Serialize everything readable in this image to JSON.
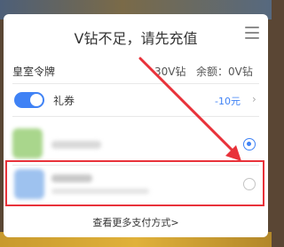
{
  "dialog": {
    "title": "V钻不足，请先充值"
  },
  "purchase": {
    "product_name": "皇室令牌",
    "price": "30V钻",
    "balance": "余额：0V钻"
  },
  "coupon": {
    "label": "礼券",
    "enabled": true,
    "value": "-10元",
    "chevron": "›"
  },
  "payment_methods": [
    {
      "selected": true
    },
    {
      "selected": false
    }
  ],
  "more_methods_link": "查看更多支付方式>",
  "colors": {
    "accent": "#3f82f5",
    "annotation": "#e8323a"
  },
  "icons": {
    "menu": "menu-icon",
    "chevron": "chevron-right-icon"
  }
}
